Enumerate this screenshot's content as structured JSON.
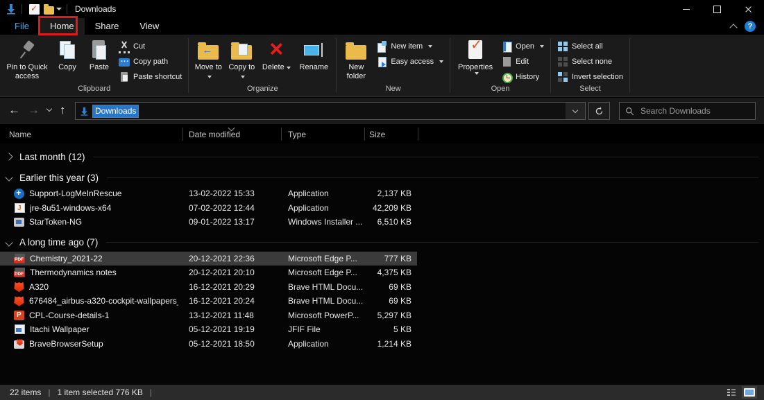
{
  "titlebar": {
    "title": "Downloads"
  },
  "tabs": {
    "file": "File",
    "home": "Home",
    "share": "Share",
    "view": "View",
    "help": "?"
  },
  "ribbon": {
    "clipboard": {
      "label": "Clipboard",
      "pin": "Pin to Quick access",
      "copy": "Copy",
      "paste": "Paste",
      "cut": "Cut",
      "copy_path": "Copy path",
      "paste_shortcut": "Paste shortcut"
    },
    "organize": {
      "label": "Organize",
      "move_to": "Move to",
      "copy_to": "Copy to",
      "delete": "Delete",
      "rename": "Rename"
    },
    "new_group": {
      "label": "New",
      "new_folder": "New folder",
      "new_item": "New item",
      "easy_access": "Easy access"
    },
    "open_group": {
      "label": "Open",
      "properties": "Properties",
      "open": "Open",
      "edit": "Edit",
      "history": "History"
    },
    "select_group": {
      "label": "Select",
      "select_all": "Select all",
      "select_none": "Select none",
      "invert": "Invert selection"
    }
  },
  "navbar": {
    "back": "←",
    "forward": "→",
    "up": "↑",
    "address": "Downloads",
    "search_placeholder": "Search Downloads"
  },
  "columns": {
    "name": "Name",
    "date": "Date modified",
    "type": "Type",
    "size": "Size"
  },
  "groups": [
    {
      "header": "Last month (12)",
      "files": []
    },
    {
      "header": "Earlier this year (3)",
      "files": [
        {
          "name": "Support-LogMeInRescue",
          "date": "13-02-2022 15:33",
          "type": "Application",
          "size": "2,137 KB",
          "icon": "logmein"
        },
        {
          "name": "jre-8u51-windows-x64",
          "date": "07-02-2022 12:44",
          "type": "Application",
          "size": "42,209 KB",
          "icon": "java"
        },
        {
          "name": "StarToken-NG",
          "date": "09-01-2022 13:17",
          "type": "Windows Installer ...",
          "size": "6,510 KB",
          "icon": "msi"
        }
      ]
    },
    {
      "header": "A long time ago (7)",
      "files": [
        {
          "name": "Chemistry_2021-22",
          "date": "20-12-2021 22:36",
          "type": "Microsoft Edge P...",
          "size": "777 KB",
          "icon": "pdf"
        },
        {
          "name": "Thermodynamics notes",
          "date": "20-12-2021 20:10",
          "type": "Microsoft Edge P...",
          "size": "4,375 KB",
          "icon": "pdf"
        },
        {
          "name": "A320",
          "date": "16-12-2021 20:29",
          "type": "Brave HTML Docu...",
          "size": "69 KB",
          "icon": "brave"
        },
        {
          "name": "676484_airbus-a320-cockpit-wallpapers_...",
          "date": "16-12-2021 20:24",
          "type": "Brave HTML Docu...",
          "size": "69 KB",
          "icon": "brave"
        },
        {
          "name": "CPL-Course-details-1",
          "date": "13-12-2021 11:48",
          "type": "Microsoft PowerP...",
          "size": "5,297 KB",
          "icon": "ppt"
        },
        {
          "name": "Itachi Wallpaper",
          "date": "05-12-2021 19:19",
          "type": "JFIF File",
          "size": "5 KB",
          "icon": "image"
        },
        {
          "name": "BraveBrowserSetup",
          "date": "05-12-2021 18:50",
          "type": "Application",
          "size": "1,214 KB",
          "icon": "setup"
        }
      ]
    }
  ],
  "statusbar": {
    "count": "22 items",
    "sep": "|",
    "selection": "1 item selected  776 KB"
  },
  "colors": {
    "accent": "#0078d7",
    "selection_bg": "#3b3b3b",
    "annotation": "#e01a1a",
    "downloads_icon": "#2f86d6"
  }
}
